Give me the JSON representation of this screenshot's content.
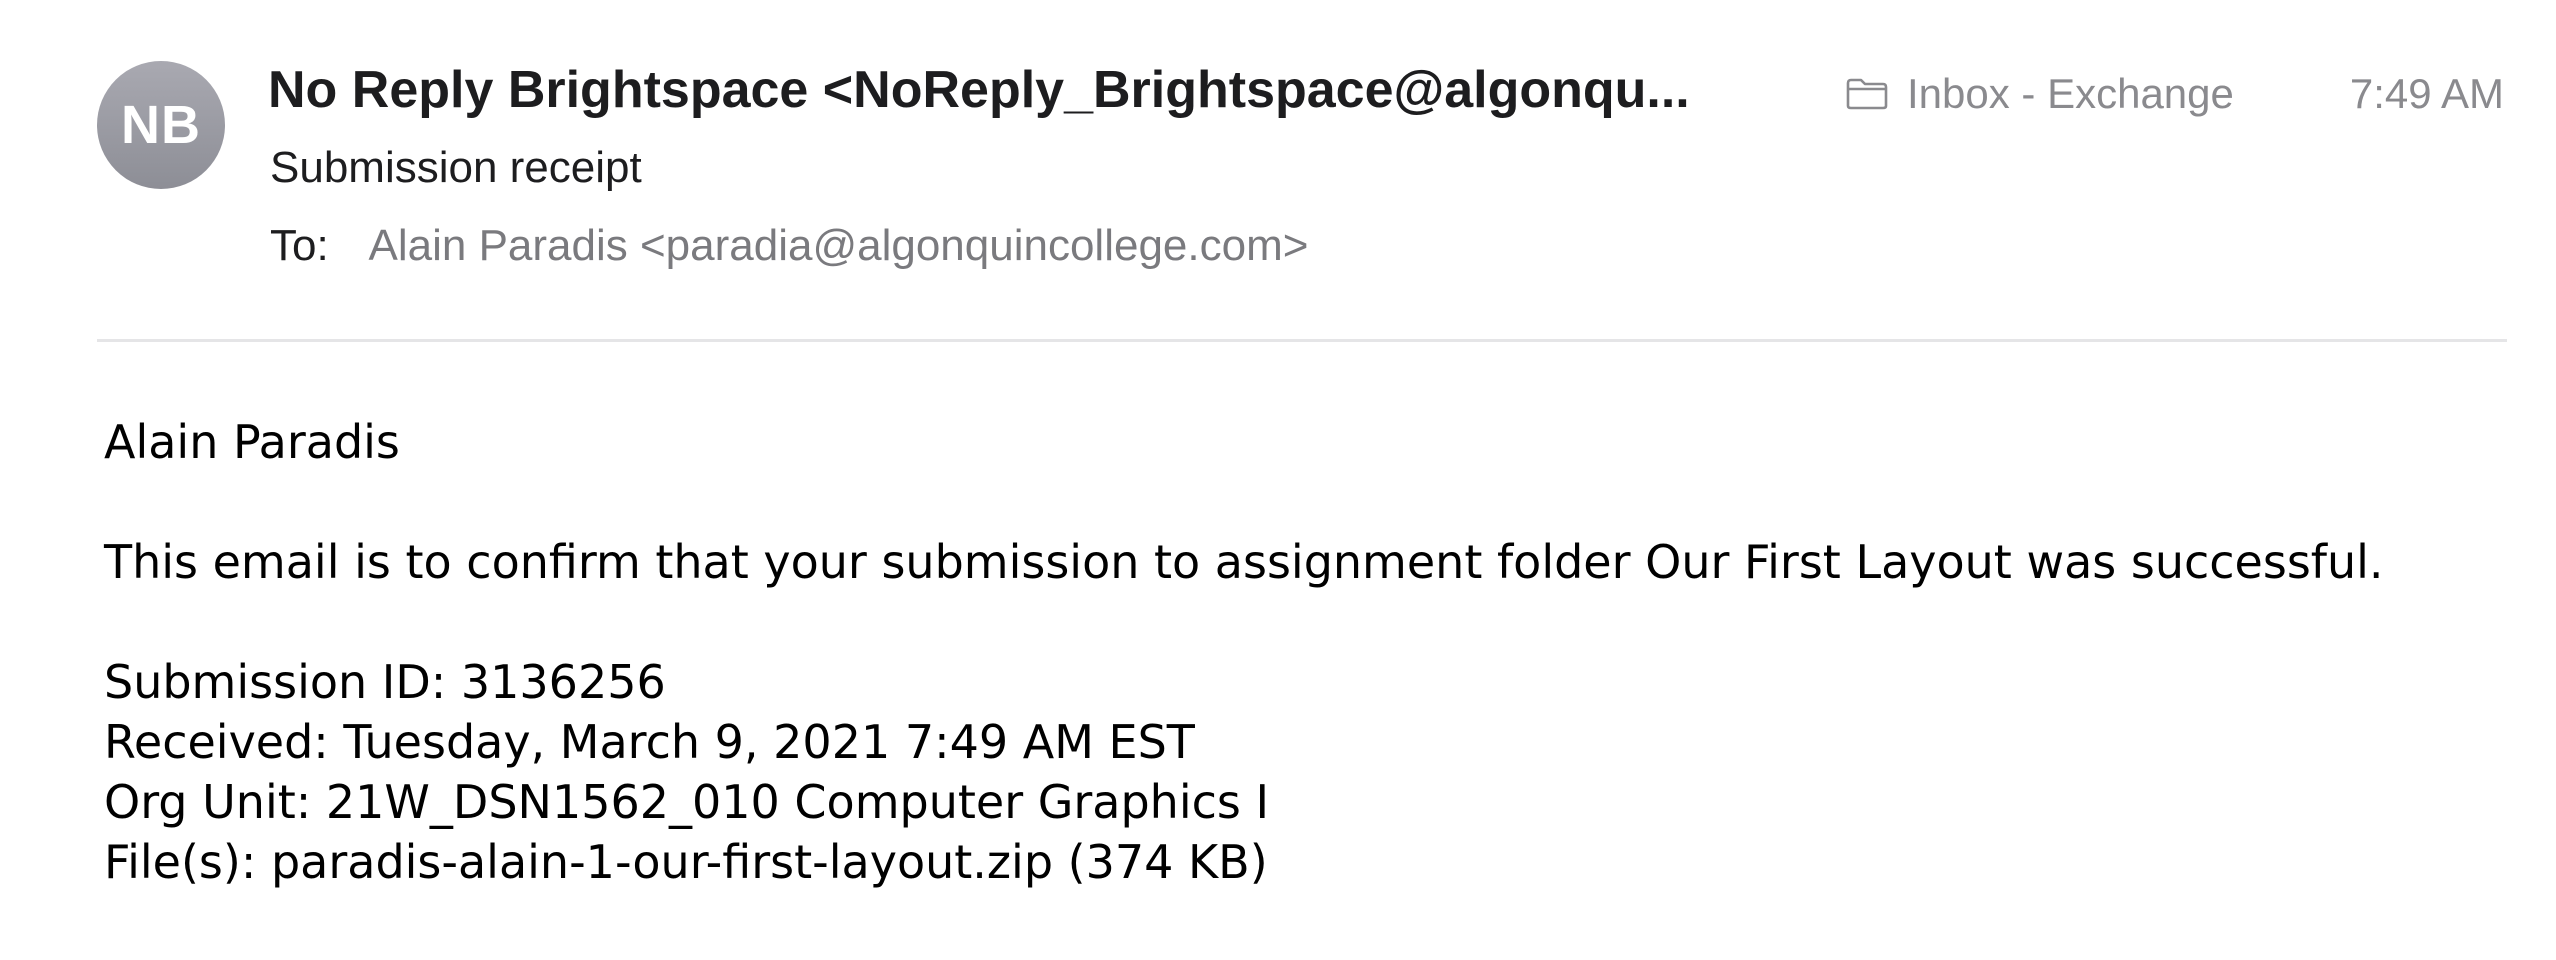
{
  "header": {
    "avatar_initials": "NB",
    "sender": "No Reply Brightspace <NoReply_Brightspace@algonqu...",
    "subject": "Submission receipt",
    "to_label": "To:",
    "to_value": "Alain Paradis <paradia@algonquincollege.com>",
    "mailbox": "Inbox - Exchange",
    "mailbox_icon": "folder-icon",
    "time": "7:49 AM"
  },
  "body": {
    "greeting": "Alain Paradis",
    "confirmation": "This email is to confirm that your submission to assignment folder Our First Layout was successful.",
    "submission_id": "Submission ID: 3136256",
    "received": "Received: Tuesday, March 9, 2021 7:49 AM EST",
    "org_unit": "Org Unit: 21W_DSN1562_010 Computer Graphics I",
    "files": "File(s): paradis-alain-1-our-first-layout.zip (374 KB)"
  }
}
